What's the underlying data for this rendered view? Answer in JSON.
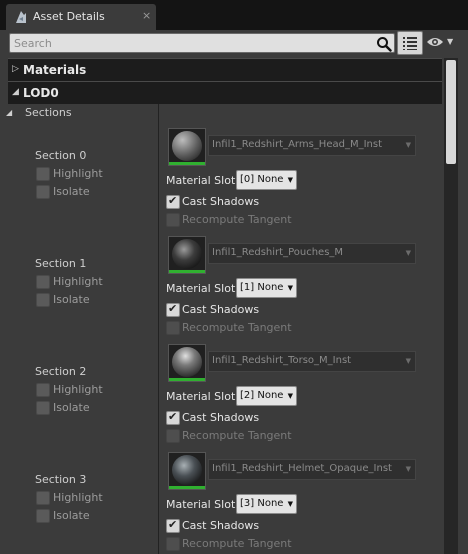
{
  "window": {
    "tab_title": "Asset Details",
    "close_glyph": "×"
  },
  "toolbar": {
    "search_placeholder": "Search",
    "search_value": "",
    "search_icon": "search-icon",
    "view_options_icon": "list-icon",
    "visibility_icon": "eye-icon"
  },
  "categories": {
    "materials": {
      "label": "Materials",
      "expanded": false
    },
    "lod0": {
      "label": "LOD0",
      "expanded": true
    }
  },
  "sections_header": {
    "label": "Sections",
    "expanded": true
  },
  "sections": [
    {
      "label": "Section 0",
      "highlight_label": "Highlight",
      "isolate_label": "Isolate",
      "highlight": false,
      "isolate": false,
      "material": "Infil1_Redshirt_Arms_Head_M_Inst",
      "slot_label": "Material Slot",
      "slot_value": "[0] None",
      "cast_shadows_label": "Cast Shadows",
      "cast_shadows": true,
      "recompute_label": "Recompute Tangent",
      "recompute": false
    },
    {
      "label": "Section 1",
      "highlight_label": "Highlight",
      "isolate_label": "Isolate",
      "highlight": false,
      "isolate": false,
      "material": "Infil1_Redshirt_Pouches_M",
      "slot_label": "Material Slot",
      "slot_value": "[1] None",
      "cast_shadows_label": "Cast Shadows",
      "cast_shadows": true,
      "recompute_label": "Recompute Tangent",
      "recompute": false
    },
    {
      "label": "Section 2",
      "highlight_label": "Highlight",
      "isolate_label": "Isolate",
      "highlight": false,
      "isolate": false,
      "material": "Infil1_Redshirt_Torso_M_Inst",
      "slot_label": "Material Slot",
      "slot_value": "[2] None",
      "cast_shadows_label": "Cast Shadows",
      "cast_shadows": true,
      "recompute_label": "Recompute Tangent",
      "recompute": false
    },
    {
      "label": "Section 3",
      "highlight_label": "Highlight",
      "isolate_label": "Isolate",
      "highlight": false,
      "isolate": false,
      "material": "Infil1_Redshirt_Helmet_Opaque_Inst",
      "slot_label": "Material Slot",
      "slot_value": "[3] None",
      "cast_shadows_label": "Cast Shadows",
      "cast_shadows": true,
      "recompute_label": "Recompute Tangent",
      "recompute": false
    }
  ],
  "colors": {
    "panel_bg": "#3b3b3b",
    "category_bg": "#1c1c1c",
    "material_indicator": "#30b030"
  }
}
